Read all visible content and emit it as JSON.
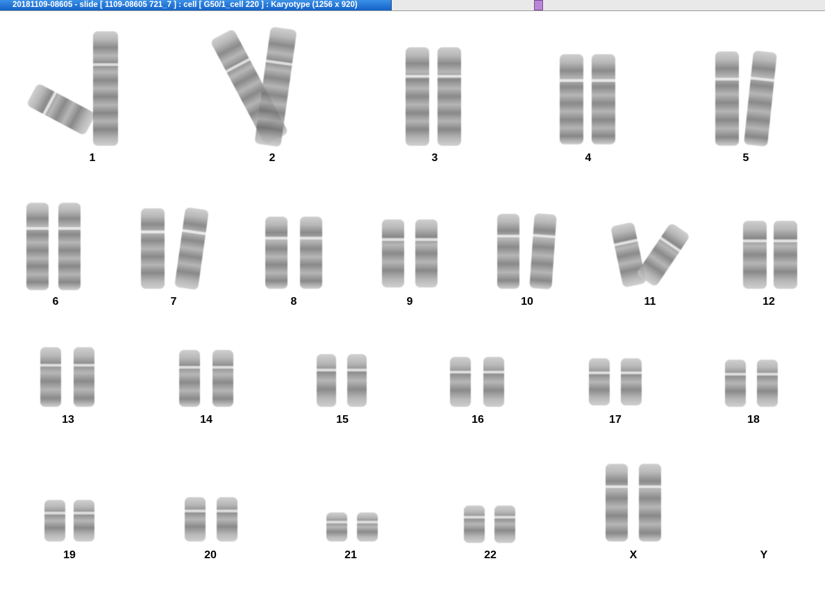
{
  "window": {
    "title": "20181109-08605 - slide [ 1109-08605 721_7 ] : cell [ G50/1_cell 220 ] : Karyotype  (1256 x 920)"
  },
  "karyotype": [
    {
      "label": "1"
    },
    {
      "label": "2"
    },
    {
      "label": "3"
    },
    {
      "label": "4"
    },
    {
      "label": "5"
    },
    {
      "label": "6"
    },
    {
      "label": "7"
    },
    {
      "label": "8"
    },
    {
      "label": "9"
    },
    {
      "label": "10"
    },
    {
      "label": "11"
    },
    {
      "label": "12"
    },
    {
      "label": "13"
    },
    {
      "label": "14"
    },
    {
      "label": "15"
    },
    {
      "label": "16"
    },
    {
      "label": "17"
    },
    {
      "label": "18"
    },
    {
      "label": "19"
    },
    {
      "label": "20"
    },
    {
      "label": "21"
    },
    {
      "label": "22"
    },
    {
      "label": "X"
    },
    {
      "label": "Y"
    }
  ]
}
